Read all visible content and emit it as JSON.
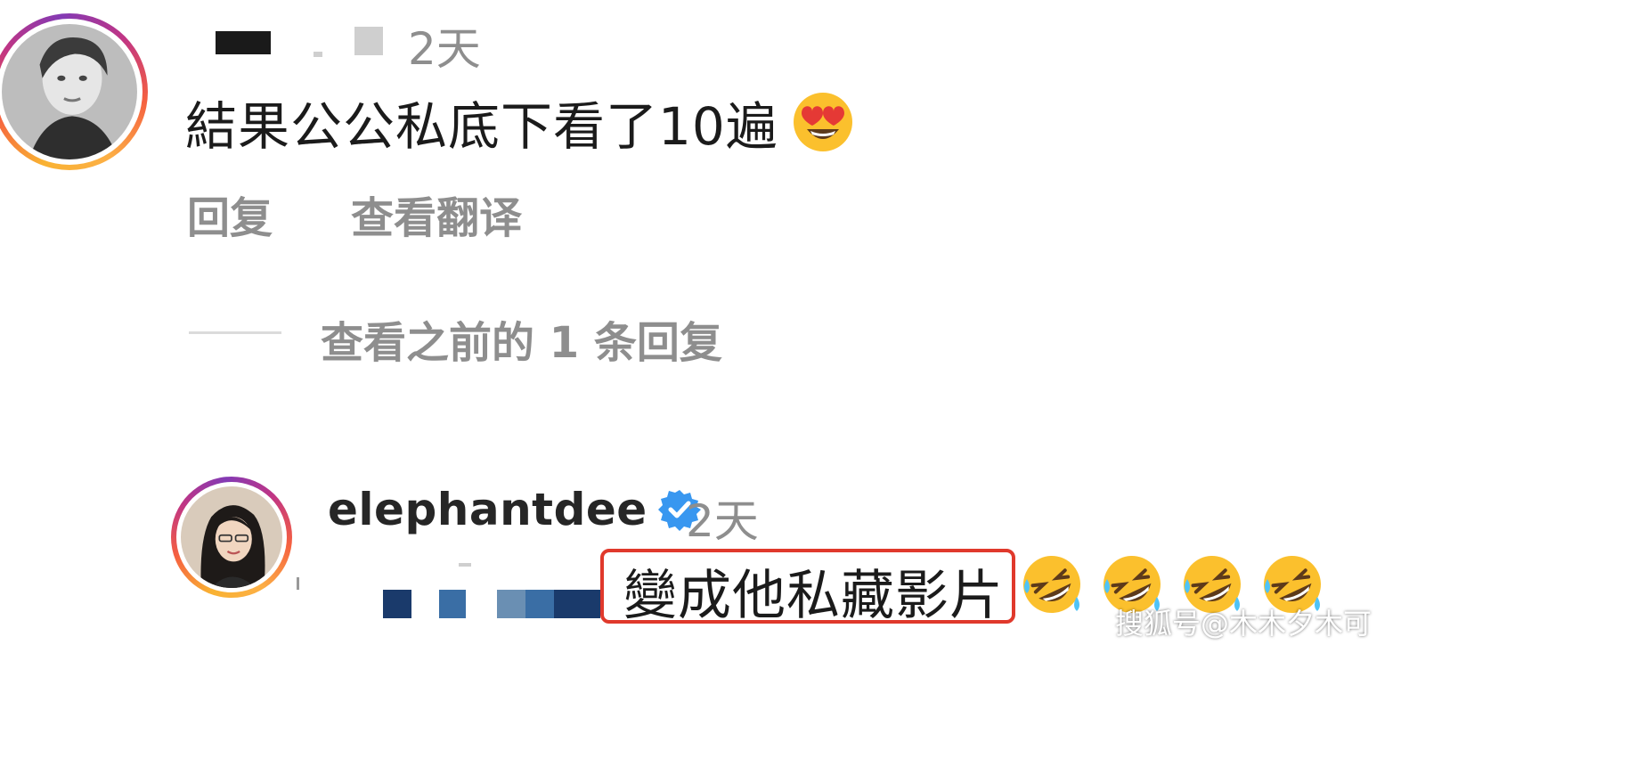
{
  "comment": {
    "time": "2天",
    "text": "結果公公私底下看了10遍",
    "reply_label": "回复",
    "translate_label": "查看翻译"
  },
  "view_replies": {
    "label": "查看之前的 1 条回复"
  },
  "reply": {
    "username": "elephantdee",
    "time": "2天",
    "text": "變成他私藏影片"
  },
  "watermark": "搜狐号@木木夕木可",
  "icons": {
    "heart_eyes": "smiling-face-with-heart-eyes-icon",
    "rofl": "rolling-on-floor-laughing-icon",
    "verified": "verified-badge-icon"
  },
  "colors": {
    "highlight": "#e0392c",
    "verified": "#3897f0",
    "muted": "#8e8e8e"
  }
}
